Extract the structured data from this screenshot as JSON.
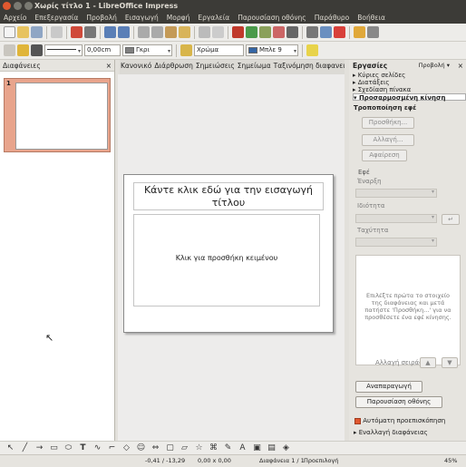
{
  "window": {
    "title": "Χωρίς τίτλο 1 - LibreOffice Impress"
  },
  "menu": [
    "Αρχείο",
    "Επεξεργασία",
    "Προβολή",
    "Εισαγωγή",
    "Μορφή",
    "Εργαλεία",
    "Παρουσίαση οθόνης",
    "Παράθυρο",
    "Βοήθεια"
  ],
  "format_toolbar": {
    "line_width": "0,00cm",
    "area_color": "Γκρι",
    "fill_style": "Χρώμα",
    "fill_color": "Μπλε 9",
    "area_color_hex": "#808080",
    "fill_color_hex": "#3465a4"
  },
  "slides_panel": {
    "title": "Διαφάνειες",
    "slide_number": "1"
  },
  "view_tabs": [
    "Κανονικό",
    "Διάρθρωση",
    "Σημειώσεις",
    "Σημείωμα",
    "Ταξινόμηση διαφανειών"
  ],
  "slide": {
    "title_placeholder": "Κάντε κλικ εδώ για την εισαγωγή τίτλου",
    "content_placeholder": "Κλικ για προσθήκη κειμένου"
  },
  "tasks": {
    "title": "Εργασίες",
    "view_label": "Προβολή",
    "tree": [
      "Κύριες σελίδες",
      "Διατάξεις",
      "Σχεδίαση πίνακα",
      "Προσαρμοσμένη κίνηση"
    ],
    "modify_effect": "Τροποποίηση εφέ",
    "add_button": "Προσθήκη...",
    "change_button": "Αλλαγή...",
    "remove_button": "Αφαίρεση",
    "effect_section": "Εφέ",
    "start_label": "Έναρξη",
    "property_label": "Ιδιότητα",
    "speed_label": "Ταχύτητα",
    "info_text": "Επιλέξτε πρώτα το στοιχείο της διαφάνειας και μετά πατήστε 'Προσθήκη...' για να προσθέσετε ένα εφέ κίνησης.",
    "reorder_label": "Αλλαγή σειράς:",
    "play_button": "Αναπαραγωγή",
    "slideshow_button": "Παρουσίαση οθόνης",
    "autopreview_label": "Αυτόματη προεπισκόπηση",
    "transition_label": "Εναλλαγή διαφάνειας"
  },
  "statusbar": {
    "position": "-0,41 / -13,29",
    "size": "0,00 x 0,00",
    "slide_info": "Διαφάνεια 1 / 1",
    "layout": "Προεπιλογή",
    "zoom": "45%"
  }
}
